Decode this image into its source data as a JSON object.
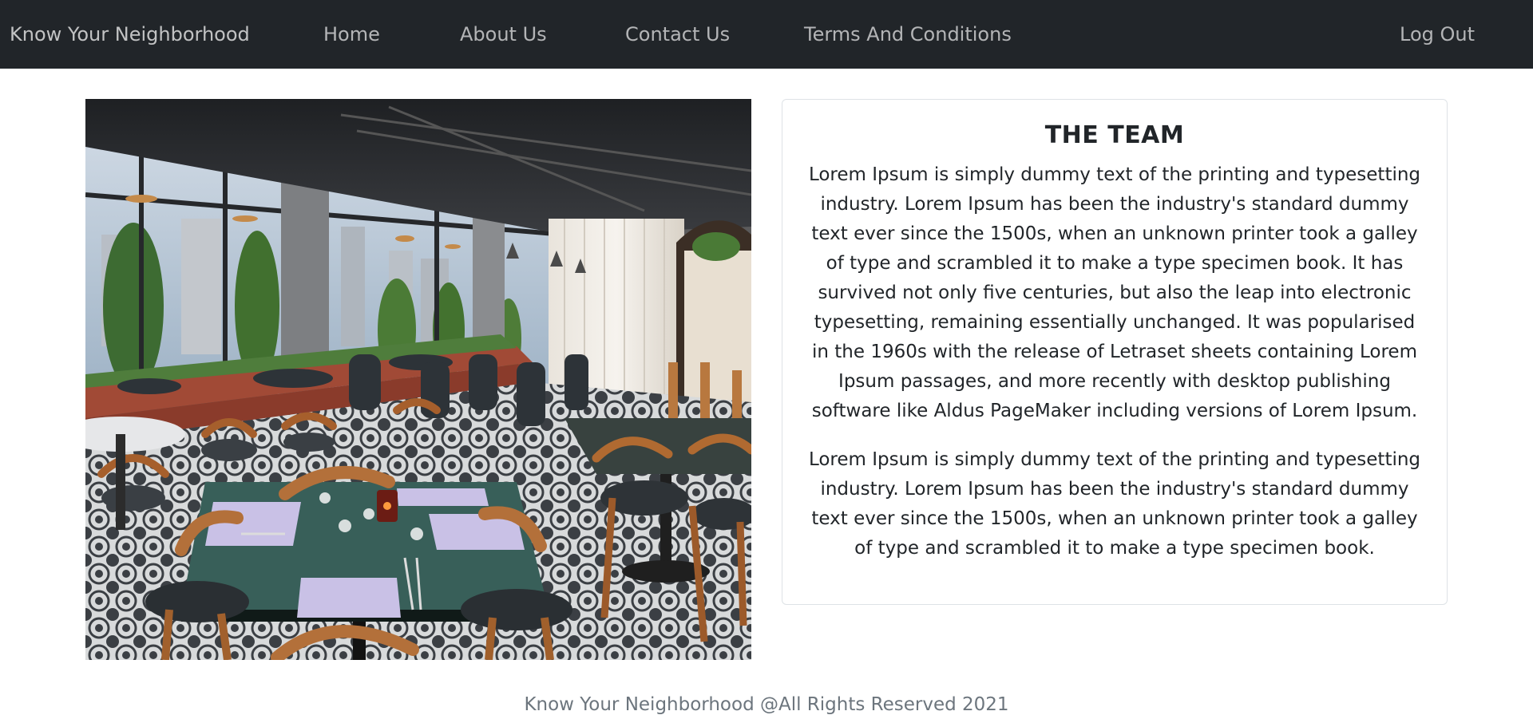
{
  "navbar": {
    "brand": "Know Your Neighborhood",
    "links": [
      {
        "label": "Home"
      },
      {
        "label": "About Us"
      },
      {
        "label": "Contact Us"
      },
      {
        "label": "Terms And Conditions"
      }
    ],
    "logout_label": "Log Out",
    "background": "#212529"
  },
  "main": {
    "image_alt_subject": "restaurant-interior-photo",
    "team": {
      "title": "THE TEAM",
      "paragraphs": [
        "Lorem Ipsum is simply dummy text of the printing and typesetting industry. Lorem Ipsum has been the industry's standard dummy text ever since the 1500s, when an unknown printer took a galley of type and scrambled it to make a type specimen book. It has survived not only five centuries, but also the leap into electronic typesetting, remaining essentially unchanged. It was popularised in the 1960s with the release of Letraset sheets containing Lorem Ipsum passages, and more recently with desktop publishing software like Aldus PageMaker including versions of Lorem Ipsum.",
        "Lorem Ipsum is simply dummy text of the printing and typesetting industry. Lorem Ipsum has been the industry's standard dummy text ever since the 1500s, when an unknown printer took a galley of type and scrambled it to make a type specimen book."
      ]
    }
  },
  "footer": {
    "text": "Know Your Neighborhood @All Rights Reserved 2021"
  }
}
